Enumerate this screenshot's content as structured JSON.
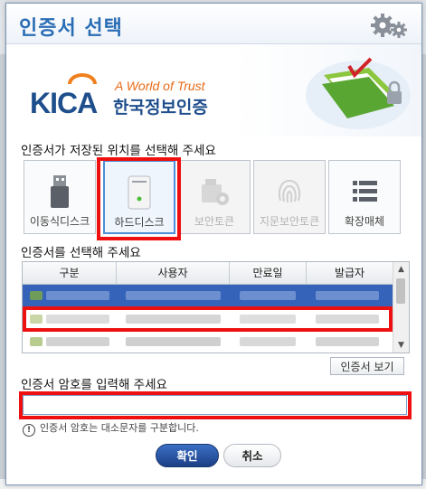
{
  "dialog": {
    "title": "인증서 선택"
  },
  "banner": {
    "tagline": "A World of Trust",
    "brand_kr": "한국정보인증",
    "brand_logo": "KICA"
  },
  "location": {
    "label": "인증서가 저장된 위치를 선택해 주세요",
    "devices": [
      {
        "label": "이동식디스크",
        "icon": "usb-drive-icon",
        "enabled": true,
        "selected": false
      },
      {
        "label": "하드디스크",
        "icon": "hard-disk-icon",
        "enabled": true,
        "selected": true
      },
      {
        "label": "보안토큰",
        "icon": "security-token-icon",
        "enabled": false,
        "selected": false
      },
      {
        "label": "지문보안토큰",
        "icon": "fingerprint-icon",
        "enabled": false,
        "selected": false
      },
      {
        "label": "확장매체",
        "icon": "list-icon",
        "enabled": true,
        "selected": false
      }
    ]
  },
  "certificates": {
    "label": "인증서를 선택해 주세요",
    "columns": [
      "구분",
      "사용자",
      "만료일",
      "발급자"
    ],
    "selected_row": 0
  },
  "view_button": "인증서 보기",
  "password": {
    "label": "인증서 암호를 입력해 주세요",
    "value": "",
    "hint": "인증서 암호는 대소문자를 구분합니다."
  },
  "buttons": {
    "ok": "확인",
    "cancel": "취소"
  },
  "colors": {
    "accent": "#2a6db5",
    "highlight": "#ee1010",
    "selection": "#3563b9"
  }
}
